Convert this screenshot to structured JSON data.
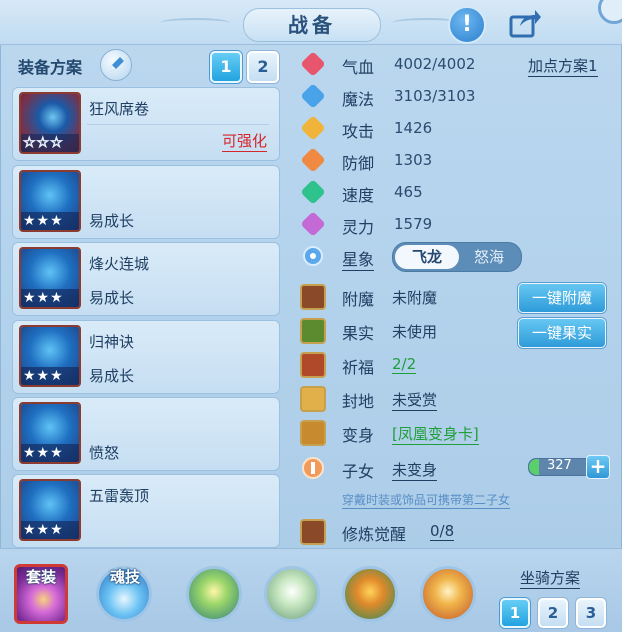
{
  "header": {
    "title": "战备",
    "info_icon": "exclamation-icon",
    "share_icon": "share-icon"
  },
  "equip": {
    "scheme_label": "装备方案",
    "scheme_buttons": [
      "1",
      "2"
    ],
    "items": [
      {
        "name": "狂风席卷",
        "sub": "",
        "enhance": "可强化",
        "stars_filled": 0
      },
      {
        "name": "",
        "sub": "易成长",
        "stars_filled": 3
      },
      {
        "name": "烽火连城",
        "sub": "易成长",
        "stars_filled": 3
      },
      {
        "name": "归神诀",
        "sub": "易成长",
        "stars_filled": 3
      },
      {
        "name": "",
        "sub": "愤怒",
        "stars_filled": 3
      },
      {
        "name": "五雷轰顶",
        "sub": "",
        "stars_filled": 3
      }
    ],
    "star_glyph": "★★★",
    "empty_star_glyph": "☆☆☆"
  },
  "stats": {
    "add_points": "加点方案1",
    "rows": [
      {
        "label": "气血",
        "value": "4002/4002",
        "color": "#e8566e",
        "icon": "heart-icon"
      },
      {
        "label": "魔法",
        "value": "3103/3103",
        "color": "#4aa3e8",
        "icon": "mana-icon"
      },
      {
        "label": "攻击",
        "value": "1426",
        "color": "#f0b43a",
        "icon": "sword-icon"
      },
      {
        "label": "防御",
        "value": "1303",
        "color": "#f08a42",
        "icon": "shield-icon"
      },
      {
        "label": "速度",
        "value": "465",
        "color": "#2ec28c",
        "icon": "speed-icon"
      },
      {
        "label": "灵力",
        "value": "1579",
        "color": "#c46ad6",
        "icon": "spirit-icon"
      }
    ]
  },
  "constellation": {
    "label": "星象",
    "options": [
      "飞龙",
      "怒海"
    ],
    "selected": "飞龙"
  },
  "features": {
    "enchant": {
      "label": "附魔",
      "value": "未附魔",
      "button": "一键附魔"
    },
    "fruit": {
      "label": "果实",
      "value": "未使用",
      "button": "一键果实"
    },
    "blessing": {
      "label": "祈福",
      "value": "2/2"
    },
    "fiefdom": {
      "label": "封地",
      "value": "未受赏"
    },
    "transform": {
      "label": "变身",
      "value": "[凤凰变身卡]"
    },
    "children": {
      "label": "子女",
      "value": "未变身",
      "count": "327",
      "hint": "穿戴时装或饰品可携带第二子女"
    },
    "cultivation": {
      "label": "修炼觉醒",
      "value": "0/8"
    }
  },
  "bottom": {
    "suit_label": "套装",
    "soul_label": "魂技",
    "mount_label": "坐骑方案",
    "mount_buttons": [
      "1",
      "2",
      "3"
    ]
  },
  "colors": {
    "accent": "#22a3e0",
    "warning": "#d4262b",
    "success": "#1f9e3a"
  }
}
